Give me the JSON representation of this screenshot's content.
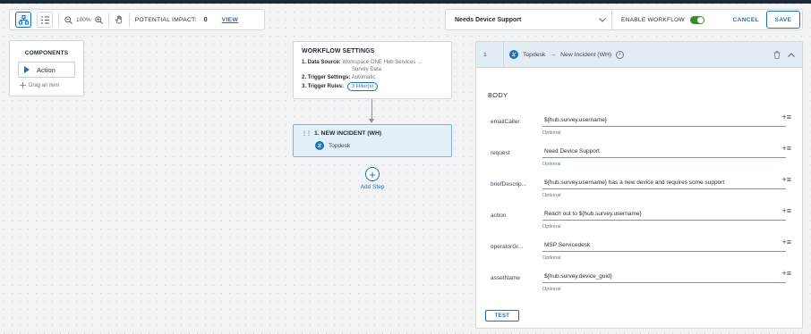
{
  "toolbar": {
    "zoom": "100%",
    "impact_label": "POTENTIAL IMPACT:",
    "impact_value": "0",
    "view_link": "VIEW"
  },
  "header": {
    "workflow_select": "Needs Device Support",
    "enable_label": "ENABLE WORKFLOW",
    "enable_on": true,
    "cancel": "CANCEL",
    "save": "SAVE"
  },
  "components": {
    "title": "COMPONENTS",
    "action_label": "Action",
    "drag_hint": "Drag an item"
  },
  "workflow_settings": {
    "title": "WORKFLOW SETTINGS",
    "data_source_label": "1. Data Source:",
    "data_source_value": "Workspace ONE Hub Services →",
    "data_source_value_2": "Survey Data",
    "trigger_settings_label": "2. Trigger Settings:",
    "trigger_settings_value": "Automatic",
    "trigger_rules_label": "3. Trigger Rules:",
    "trigger_rules_chip": "3 Filter(s)"
  },
  "node": {
    "title": "1. NEW INCIDENT (WH)",
    "connector": "Topdesk"
  },
  "add_step": "Add Step",
  "panel": {
    "step_number": "1",
    "breadcrumb_source": "Topdesk",
    "breadcrumb_arrow": "→",
    "breadcrumb_target": "New Incident (WH)",
    "body_title": "BODY",
    "fields": [
      {
        "label": "emailCaller",
        "value": "${hub.survey.username}",
        "hint": "Optional"
      },
      {
        "label": "request",
        "value": "Need Device Support",
        "hint": "Optional"
      },
      {
        "label": "briefDescrip...",
        "value": "${hub.survey.username} has a new device and requires some support",
        "hint": "Optional"
      },
      {
        "label": "action",
        "value": "Reach out to ${hub.survey.username}",
        "hint": "Optional"
      },
      {
        "label": "operatorGr...",
        "value": "MSP Servicedesk",
        "hint": "Optional"
      },
      {
        "label": "assetName",
        "value": "${hub.survey.device_guid}",
        "hint": "Optional"
      }
    ],
    "test_button": "TEST"
  },
  "colors": {
    "accent": "#1d6fb8",
    "toggle_on": "#3a8b2c",
    "node_fill": "#e3f0fa"
  }
}
